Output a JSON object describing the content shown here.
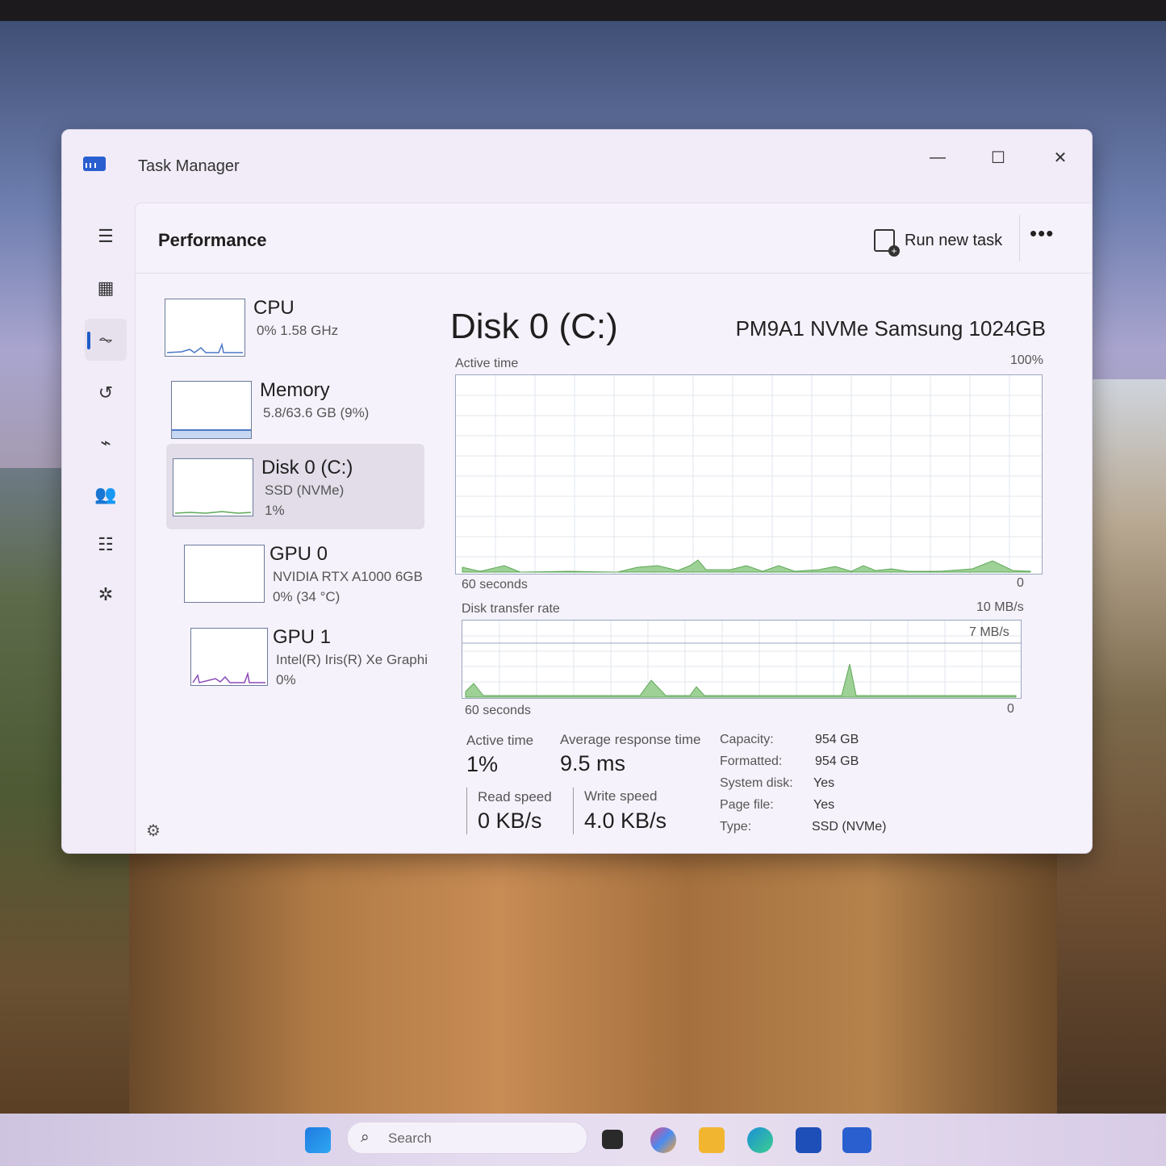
{
  "window": {
    "title": "Task Manager",
    "minimize": "—",
    "maximize": "☐",
    "close": "✕"
  },
  "header": {
    "page_title": "Performance",
    "run_new_task": "Run new task",
    "more": "•••"
  },
  "nav": {
    "icons": [
      "hamburger-icon",
      "processes-icon",
      "performance-icon",
      "app-history-icon",
      "startup-icon",
      "users-icon",
      "details-icon",
      "services-icon",
      "settings-icon"
    ]
  },
  "devices": [
    {
      "name": "CPU",
      "sub": "0%  1.58 GHz",
      "sub2": ""
    },
    {
      "name": "Memory",
      "sub": "5.8/63.6 GB (9%)",
      "sub2": ""
    },
    {
      "name": "Disk 0 (C:)",
      "sub": "SSD (NVMe)",
      "sub2": "1%"
    },
    {
      "name": "GPU 0",
      "sub": "NVIDIA RTX A1000 6GB",
      "sub2": "0%  (34 °C)"
    },
    {
      "name": "GPU 1",
      "sub": "Intel(R) Iris(R) Xe Graphi",
      "sub2": "0%"
    }
  ],
  "detail": {
    "title": "Disk 0 (C:)",
    "model": "PM9A1 NVMe Samsung 1024GB",
    "active_time_label": "Active time",
    "active_max": "100%",
    "active_x_left": "60 seconds",
    "active_x_right": "0",
    "transfer_label": "Disk transfer rate",
    "transfer_max": "10 MB/s",
    "transfer_mid": "7 MB/s",
    "transfer_x_left": "60 seconds",
    "transfer_x_right": "0",
    "stats": {
      "active_time_label": "Active time",
      "active_time": "1%",
      "avg_response_label": "Average response time",
      "avg_response": "9.5 ms",
      "read_label": "Read speed",
      "read": "0 KB/s",
      "write_label": "Write speed",
      "write": "4.0 KB/s"
    },
    "props": [
      {
        "key": "Capacity:",
        "val": "954 GB"
      },
      {
        "key": "Formatted:",
        "val": "954 GB"
      },
      {
        "key": "System disk:",
        "val": "Yes"
      },
      {
        "key": "Page file:",
        "val": "Yes"
      },
      {
        "key": "Type:",
        "val": "SSD (NVMe)"
      }
    ]
  },
  "taskbar": {
    "search_placeholder": "Search"
  },
  "colors": {
    "accent": "#1e5cc8",
    "graph_fill": "#9ed196",
    "graph_line": "#5fa85a"
  }
}
